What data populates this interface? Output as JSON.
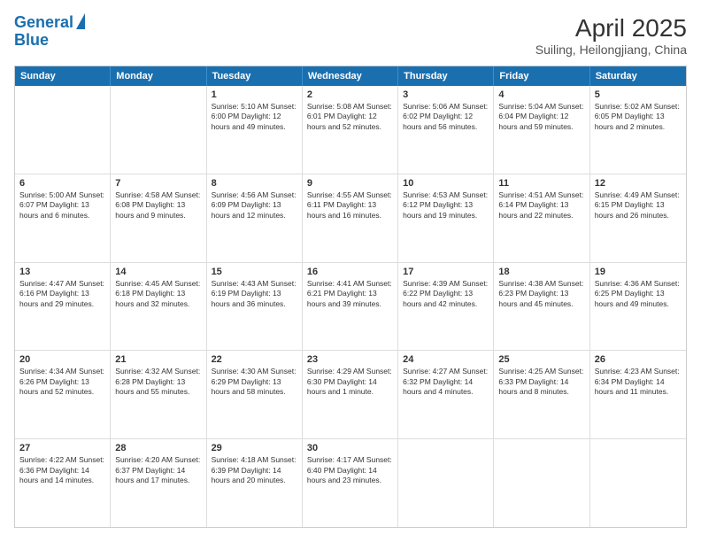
{
  "logo": {
    "line1": "General",
    "line2": "Blue"
  },
  "title": "April 2025",
  "subtitle": "Suiling, Heilongjiang, China",
  "header_days": [
    "Sunday",
    "Monday",
    "Tuesday",
    "Wednesday",
    "Thursday",
    "Friday",
    "Saturday"
  ],
  "rows": [
    [
      {
        "day": "",
        "text": ""
      },
      {
        "day": "",
        "text": ""
      },
      {
        "day": "1",
        "text": "Sunrise: 5:10 AM\nSunset: 6:00 PM\nDaylight: 12 hours\nand 49 minutes."
      },
      {
        "day": "2",
        "text": "Sunrise: 5:08 AM\nSunset: 6:01 PM\nDaylight: 12 hours\nand 52 minutes."
      },
      {
        "day": "3",
        "text": "Sunrise: 5:06 AM\nSunset: 6:02 PM\nDaylight: 12 hours\nand 56 minutes."
      },
      {
        "day": "4",
        "text": "Sunrise: 5:04 AM\nSunset: 6:04 PM\nDaylight: 12 hours\nand 59 minutes."
      },
      {
        "day": "5",
        "text": "Sunrise: 5:02 AM\nSunset: 6:05 PM\nDaylight: 13 hours\nand 2 minutes."
      }
    ],
    [
      {
        "day": "6",
        "text": "Sunrise: 5:00 AM\nSunset: 6:07 PM\nDaylight: 13 hours\nand 6 minutes."
      },
      {
        "day": "7",
        "text": "Sunrise: 4:58 AM\nSunset: 6:08 PM\nDaylight: 13 hours\nand 9 minutes."
      },
      {
        "day": "8",
        "text": "Sunrise: 4:56 AM\nSunset: 6:09 PM\nDaylight: 13 hours\nand 12 minutes."
      },
      {
        "day": "9",
        "text": "Sunrise: 4:55 AM\nSunset: 6:11 PM\nDaylight: 13 hours\nand 16 minutes."
      },
      {
        "day": "10",
        "text": "Sunrise: 4:53 AM\nSunset: 6:12 PM\nDaylight: 13 hours\nand 19 minutes."
      },
      {
        "day": "11",
        "text": "Sunrise: 4:51 AM\nSunset: 6:14 PM\nDaylight: 13 hours\nand 22 minutes."
      },
      {
        "day": "12",
        "text": "Sunrise: 4:49 AM\nSunset: 6:15 PM\nDaylight: 13 hours\nand 26 minutes."
      }
    ],
    [
      {
        "day": "13",
        "text": "Sunrise: 4:47 AM\nSunset: 6:16 PM\nDaylight: 13 hours\nand 29 minutes."
      },
      {
        "day": "14",
        "text": "Sunrise: 4:45 AM\nSunset: 6:18 PM\nDaylight: 13 hours\nand 32 minutes."
      },
      {
        "day": "15",
        "text": "Sunrise: 4:43 AM\nSunset: 6:19 PM\nDaylight: 13 hours\nand 36 minutes."
      },
      {
        "day": "16",
        "text": "Sunrise: 4:41 AM\nSunset: 6:21 PM\nDaylight: 13 hours\nand 39 minutes."
      },
      {
        "day": "17",
        "text": "Sunrise: 4:39 AM\nSunset: 6:22 PM\nDaylight: 13 hours\nand 42 minutes."
      },
      {
        "day": "18",
        "text": "Sunrise: 4:38 AM\nSunset: 6:23 PM\nDaylight: 13 hours\nand 45 minutes."
      },
      {
        "day": "19",
        "text": "Sunrise: 4:36 AM\nSunset: 6:25 PM\nDaylight: 13 hours\nand 49 minutes."
      }
    ],
    [
      {
        "day": "20",
        "text": "Sunrise: 4:34 AM\nSunset: 6:26 PM\nDaylight: 13 hours\nand 52 minutes."
      },
      {
        "day": "21",
        "text": "Sunrise: 4:32 AM\nSunset: 6:28 PM\nDaylight: 13 hours\nand 55 minutes."
      },
      {
        "day": "22",
        "text": "Sunrise: 4:30 AM\nSunset: 6:29 PM\nDaylight: 13 hours\nand 58 minutes."
      },
      {
        "day": "23",
        "text": "Sunrise: 4:29 AM\nSunset: 6:30 PM\nDaylight: 14 hours\nand 1 minute."
      },
      {
        "day": "24",
        "text": "Sunrise: 4:27 AM\nSunset: 6:32 PM\nDaylight: 14 hours\nand 4 minutes."
      },
      {
        "day": "25",
        "text": "Sunrise: 4:25 AM\nSunset: 6:33 PM\nDaylight: 14 hours\nand 8 minutes."
      },
      {
        "day": "26",
        "text": "Sunrise: 4:23 AM\nSunset: 6:34 PM\nDaylight: 14 hours\nand 11 minutes."
      }
    ],
    [
      {
        "day": "27",
        "text": "Sunrise: 4:22 AM\nSunset: 6:36 PM\nDaylight: 14 hours\nand 14 minutes."
      },
      {
        "day": "28",
        "text": "Sunrise: 4:20 AM\nSunset: 6:37 PM\nDaylight: 14 hours\nand 17 minutes."
      },
      {
        "day": "29",
        "text": "Sunrise: 4:18 AM\nSunset: 6:39 PM\nDaylight: 14 hours\nand 20 minutes."
      },
      {
        "day": "30",
        "text": "Sunrise: 4:17 AM\nSunset: 6:40 PM\nDaylight: 14 hours\nand 23 minutes."
      },
      {
        "day": "",
        "text": ""
      },
      {
        "day": "",
        "text": ""
      },
      {
        "day": "",
        "text": ""
      }
    ]
  ]
}
